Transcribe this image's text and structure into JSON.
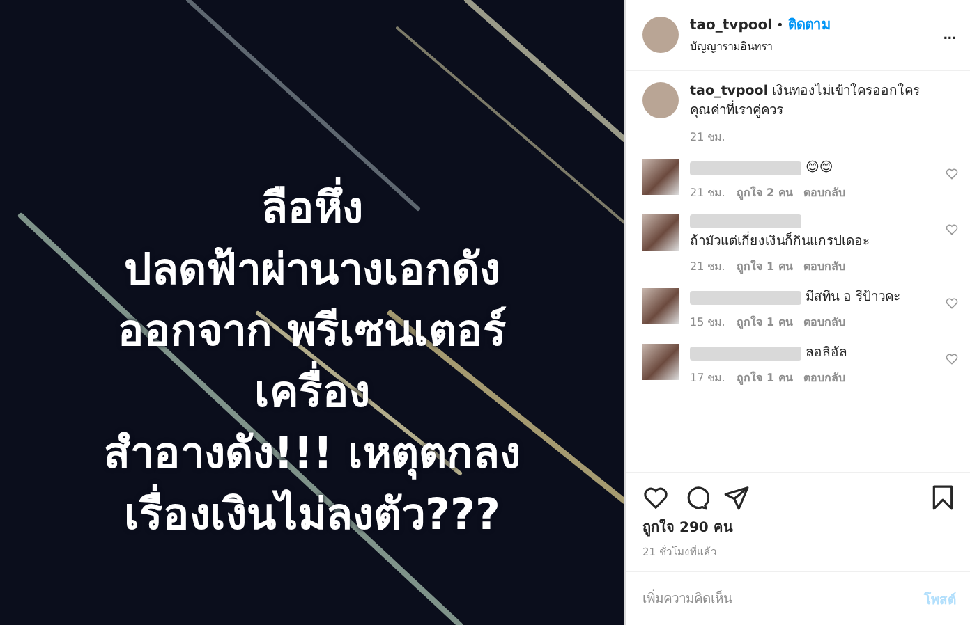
{
  "post_image": {
    "text_lines": [
      "ลือหึ่ง",
      "ปลดฟ้าผ่านางเอกดัง",
      "ออกจาก พรีเซนเตอร์",
      "เครื่อง",
      "สำอางดัง!!! เหตุตกลง",
      "เรื่องเงินไม่ลงตัว???"
    ]
  },
  "header": {
    "username": "tao_tvpool",
    "separator": "•",
    "follow": "ติดตาม",
    "location": "บัญญารามอินทรา",
    "more": "..."
  },
  "caption": {
    "username": "tao_tvpool",
    "text": "เงินทองไม่เข้าใครออกใคร คุณค่าที่เราคู่ควร",
    "time": "21 ชม."
  },
  "comments": [
    {
      "text": "😊😊",
      "time": "21 ชม.",
      "likes": "ถูกใจ 2 คน",
      "reply": "ตอบกลับ"
    },
    {
      "text": "ถ้ามัวแต่เกี่ยงเงินก็กินแกรปเดอะ",
      "time": "21 ชม.",
      "likes": "ถูกใจ 1 คน",
      "reply": "ตอบกลับ"
    },
    {
      "text": "มีสทีน อ รีป้าวคะ",
      "time": "15 ชม.",
      "likes": "ถูกใจ 1 คน",
      "reply": "ตอบกลับ"
    },
    {
      "text": "ลอลิอัล",
      "time": "17 ชม.",
      "likes": "ถูกใจ 1 คน",
      "reply": "ตอบกลับ"
    }
  ],
  "likes": "ถูกใจ 290 คน",
  "posted": "21 ชั่วโมงที่แล้ว",
  "add_comment": {
    "placeholder": "เพิ่มความคิดเห็น",
    "post_button": "โพสต์",
    "disabled": true
  }
}
